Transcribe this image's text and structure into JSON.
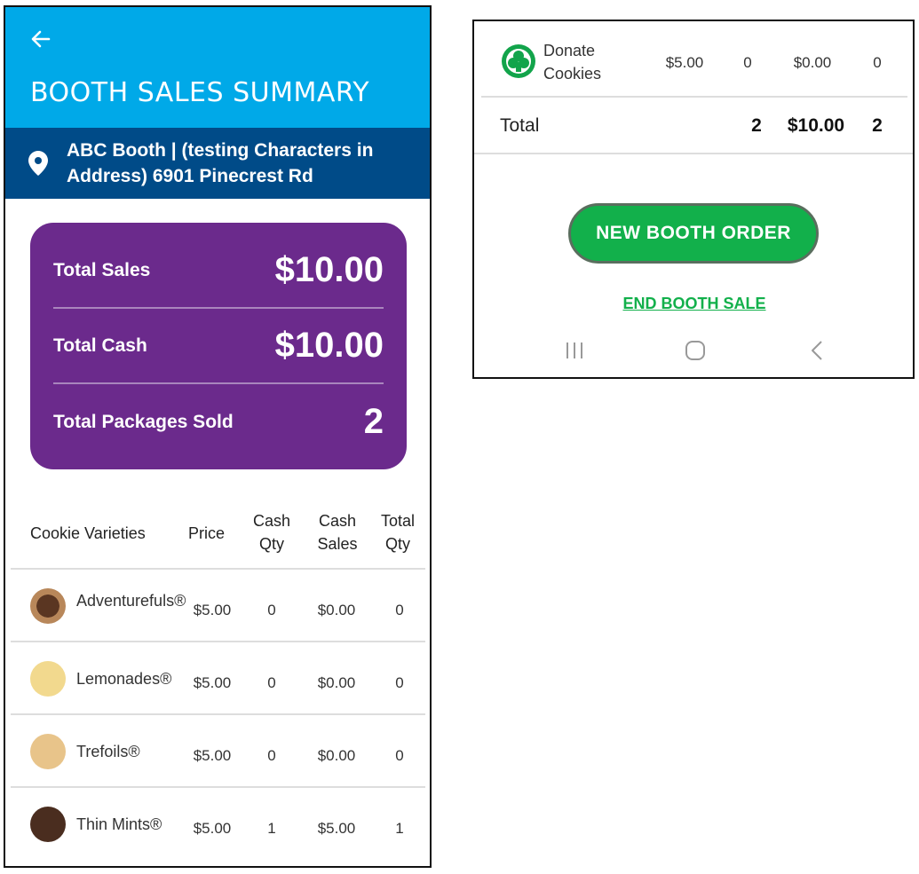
{
  "header": {
    "title": "BOOTH SALES SUMMARY",
    "back_icon": "arrow-left-icon"
  },
  "location": {
    "icon": "map-pin-icon",
    "text": "ABC Booth | (testing Characters in Address) 6901 Pinecrest Rd"
  },
  "summary": {
    "rows": [
      {
        "label": "Total Sales",
        "value": "$10.00"
      },
      {
        "label": "Total Cash",
        "value": "$10.00"
      },
      {
        "label": "Total Packages Sold",
        "value": "2"
      }
    ]
  },
  "table": {
    "headers": {
      "variety": "Cookie Varieties",
      "price": "Price",
      "cash_qty": "Cash Qty",
      "cash_sales": "Cash Sales",
      "total_qty": "Total Qty"
    },
    "rows": [
      {
        "name": "Adventurefuls®",
        "price": "$5.00",
        "cash_qty": "0",
        "cash_sales": "$0.00",
        "total_qty": "0",
        "icon_color": "#b8875a",
        "ring_color": "#c9a77f"
      },
      {
        "name": "Lemonades®",
        "price": "$5.00",
        "cash_qty": "0",
        "cash_sales": "$0.00",
        "total_qty": "0",
        "icon_color": "#f2d98e",
        "ring_color": "#f5e400"
      },
      {
        "name": "Trefoils®",
        "price": "$5.00",
        "cash_qty": "0",
        "cash_sales": "$0.00",
        "total_qty": "0",
        "icon_color": "#e8c48a",
        "ring_color": "#1c8fd0"
      },
      {
        "name": "Thin Mints®",
        "price": "$5.00",
        "cash_qty": "1",
        "cash_sales": "$5.00",
        "total_qty": "1",
        "icon_color": "#4a2d1f",
        "ring_color": "#1ca24a"
      }
    ],
    "donate": {
      "name": "Donate Cookies",
      "price": "$5.00",
      "cash_qty": "0",
      "cash_sales": "$0.00",
      "total_qty": "0",
      "icon": "trefoil-icon",
      "icon_color": "#12a44b"
    },
    "total": {
      "label": "Total",
      "cash_qty": "2",
      "cash_sales": "$10.00",
      "total_qty": "2"
    }
  },
  "actions": {
    "new_order": "NEW BOOTH ORDER",
    "end_sale": "END BOOTH SALE"
  },
  "nav": {
    "recents_icon": "recents-icon",
    "home_icon": "home-icon",
    "back_icon": "back-icon"
  },
  "colors": {
    "header_blue": "#00a9e8",
    "location_navy": "#004b88",
    "summary_purple": "#6b2a8c",
    "action_green": "#12b04b"
  }
}
